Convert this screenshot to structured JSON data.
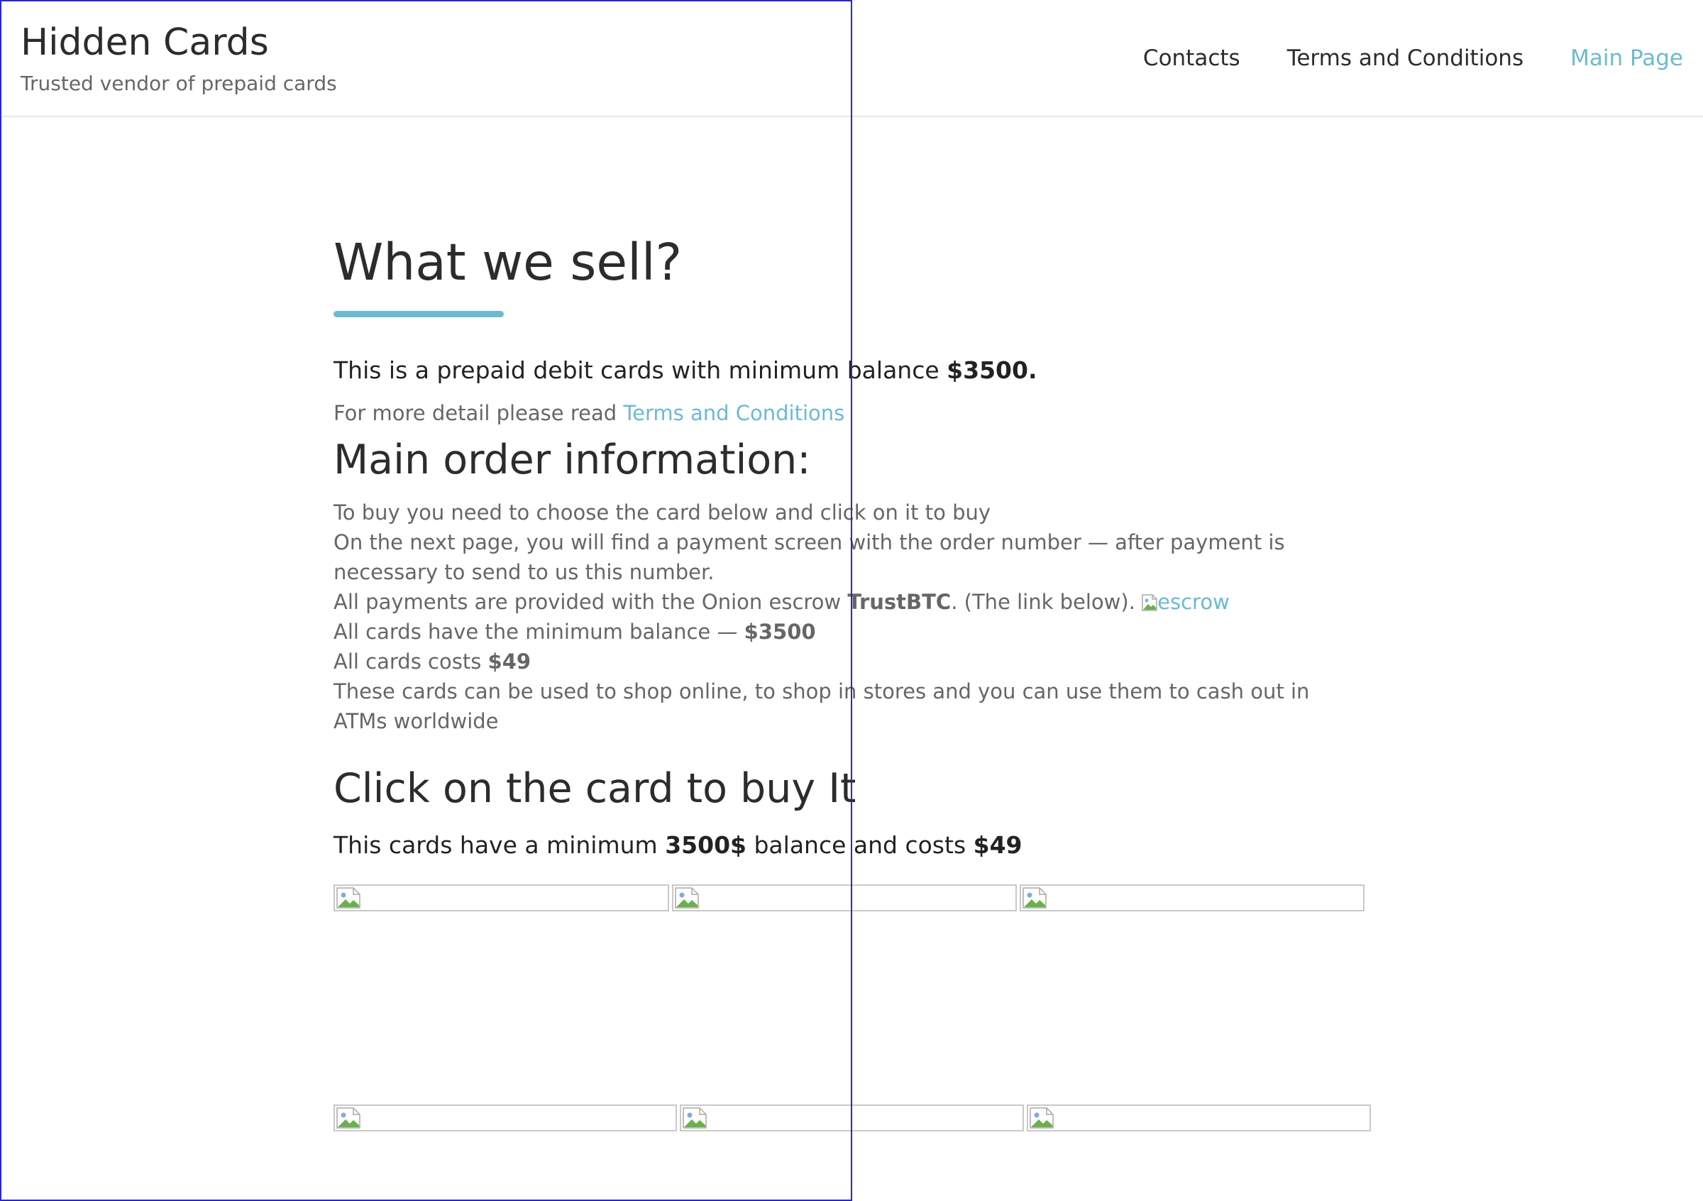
{
  "header": {
    "site_title": "Hidden Cards",
    "tagline": "Trusted vendor of prepaid cards",
    "nav": [
      {
        "label": "Contacts",
        "active": false
      },
      {
        "label": "Terms and Conditions",
        "active": false
      },
      {
        "label": "Main Page",
        "active": true
      }
    ]
  },
  "colors": {
    "accent": "#6cbad2",
    "heading": "#2c2c2c",
    "body_text": "#666666",
    "overlay_border": "#2727d4"
  },
  "intro": {
    "heading": "What we sell?",
    "lead_text": "This is a prepaid debit cards with minimum balance ",
    "lead_amount": "$3500.",
    "detail_text": "For more detail please read ",
    "detail_link": "Terms and Conditions"
  },
  "order_info": {
    "heading": "Main order information:",
    "line1": "To buy you need to choose the card below and click on it to buy",
    "line2": "On the next page, you will find a payment screen with the order number — after payment is necessary to send to us this number.",
    "line3_prefix": "All payments are provided with the Onion escrow ",
    "line3_bold": "TrustBTC",
    "line3_suffix": ". (The link below). ",
    "escrow_alt": "escrow",
    "line4_prefix": "All cards have the minimum balance — ",
    "line4_bold": "$3500",
    "line5_prefix": "All cards costs ",
    "line5_bold": "$49",
    "line6": "These cards can be used to shop online, to shop in stores and you can use them to cash out in ATMs worldwide"
  },
  "buy_section": {
    "heading": "Click on the card to buy It",
    "desc_prefix": "This cards have a minimum ",
    "desc_bold1": "3500$",
    "desc_middle": " balance and costs ",
    "desc_bold2": "$49",
    "card_rows": [
      {
        "cards": [
          "card-1",
          "card-2",
          "card-3"
        ]
      },
      {
        "cards": [
          "card-4",
          "card-5",
          "card-6"
        ]
      }
    ]
  }
}
